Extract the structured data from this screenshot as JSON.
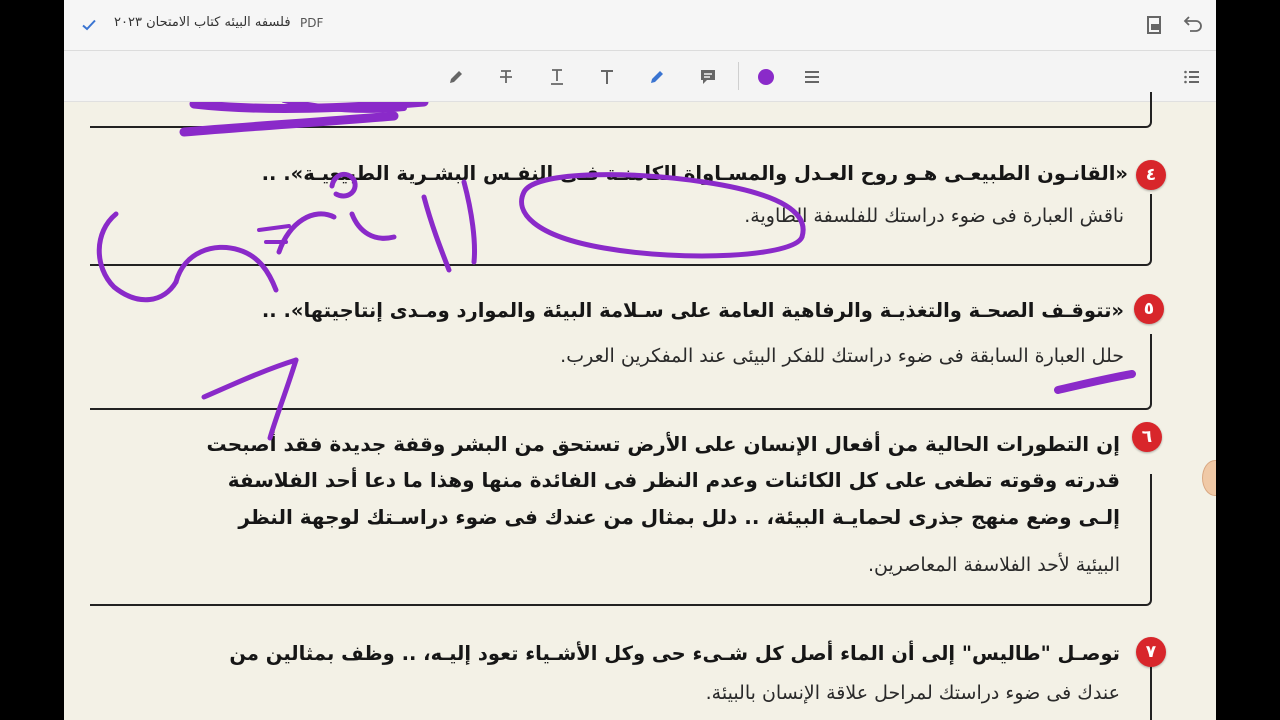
{
  "window": {
    "title": "فلسفه البيئه كتاب الامتحان ٢٠٢٣",
    "file_type": "PDF"
  },
  "icons": {
    "check": "checkmark-icon",
    "mobile_view": "mobile-view-icon",
    "undo": "undo-icon",
    "pen": "pen-icon",
    "strikethrough": "strikethrough-icon",
    "underline": "underline-text-icon",
    "text": "add-text-icon",
    "highlighter": "highlighter-icon",
    "comment": "comment-icon",
    "color": "color-picker-icon",
    "stroke_width": "stroke-width-icon",
    "outline": "outline-list-icon"
  },
  "colors": {
    "ink": "#8a2ac9",
    "accent": "#3a74d1",
    "badge": "#d8262b"
  },
  "questions": [
    {
      "number": "٤",
      "line1": "«القانـون الطبيعـى هـو روح العـدل والمسـاواة الكامنـة فـى النفـس البشـرية الطبيعيـة». ..",
      "line2": "ناقش العبارة فى ضوء دراستك للفلسفة الطاوية."
    },
    {
      "number": "٥",
      "line1": "«تتوقـف الصحـة والتغذيـة والرفاهية العامة على سـلامة البيئة والموارد ومـدى إنتاجيتها». ..",
      "line2": "حلل العبارة السابقة فى ضوء دراستك للفكر البيئى عند المفكرين العرب."
    },
    {
      "number": "٦",
      "line1": "إن التطورات الحالية من أفعال الإنسان على الأرض تستحق من البشر وقفة جديدة فقد أصبحت",
      "line2": "قدرته وقوته تطغى على كل الكائنات وعدم النظر فى الفائدة منها وهذا ما دعا أحد الفلاسفة",
      "line3": "إلـى وضع منهج جذرى لحمايـة البيئة، .. دلل بمثال من عندك فى ضوء دراسـتك لوجهة النظر",
      "line4": "البيئية لأحد الفلاسفة المعاصرين."
    },
    {
      "number": "٧",
      "line1": "توصـل \"طاليس\" إلى أن الماء أصل كل شـىء حى وكل الأشـياء تعود إليـه، .. وظف بمثالين من",
      "line2": "عندك فى ضوء دراستك لمراحل علاقة الإنسان بالبيئة."
    }
  ]
}
